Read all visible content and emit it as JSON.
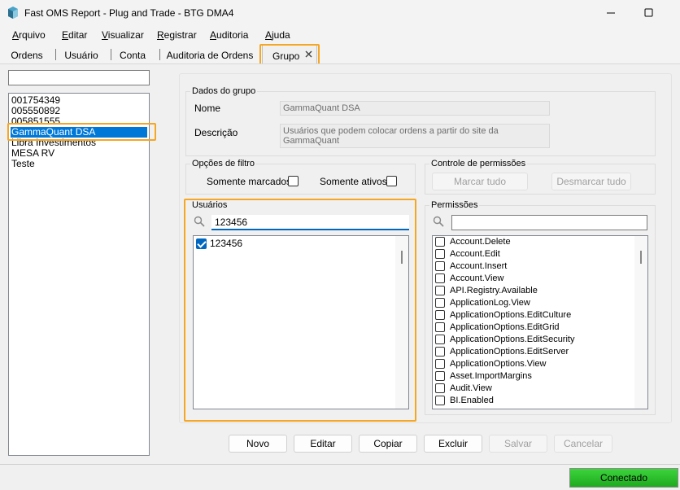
{
  "window": {
    "title": "Fast OMS Report - Plug and Trade - BTG DMA4"
  },
  "menu": [
    {
      "label": "Arquivo"
    },
    {
      "label": "Editar"
    },
    {
      "label": "Visualizar"
    },
    {
      "label": "Registrar"
    },
    {
      "label": "Auditoria"
    },
    {
      "label": "Ajuda"
    }
  ],
  "tabs": [
    {
      "label": "Ordens"
    },
    {
      "label": "Usuário"
    },
    {
      "label": "Conta"
    },
    {
      "label": "Auditoria de Ordens"
    },
    {
      "label": "Grupo",
      "active": true
    }
  ],
  "groups": {
    "search_value": "",
    "items": [
      "001754349",
      "005550892",
      "005851555",
      "GammaQuant DSA",
      "Libra Investimentos",
      "MESA RV",
      "Teste"
    ],
    "selected": "GammaQuant DSA"
  },
  "dados": {
    "legend": "Dados do grupo",
    "nome_label": "Nome",
    "nome_value": "GammaQuant DSA",
    "descricao_label": "Descrição",
    "descricao_value": "Usuários que podem colocar ordens a partir do site da GammaQuant"
  },
  "filtro": {
    "legend": "Opções de filtro",
    "somente_marcados": "Somente marcados",
    "somente_ativos": "Somente ativos"
  },
  "controle": {
    "legend": "Controle de permissões",
    "marcar_tudo": "Marcar tudo",
    "desmarcar_tudo": "Desmarcar tudo"
  },
  "usuarios": {
    "legend": "Usuários",
    "search_value": "123456",
    "items": [
      {
        "label": "123456",
        "checked": true
      }
    ]
  },
  "permissoes": {
    "legend": "Permissões",
    "search_value": "",
    "items": [
      "Account.Delete",
      "Account.Edit",
      "Account.Insert",
      "Account.View",
      "API.Registry.Available",
      "ApplicationLog.View",
      "ApplicationOptions.EditCulture",
      "ApplicationOptions.EditGrid",
      "ApplicationOptions.EditSecurity",
      "ApplicationOptions.EditServer",
      "ApplicationOptions.View",
      "Asset.ImportMargins",
      "Audit.View",
      "BI.Enabled"
    ]
  },
  "actions": {
    "novo": "Novo",
    "editar": "Editar",
    "copiar": "Copiar",
    "excluir": "Excluir",
    "salvar": "Salvar",
    "cancelar": "Cancelar"
  },
  "status": {
    "connection": "Conectado",
    "connection_color": "#2fc42f"
  },
  "colors": {
    "highlight": "#f5a623",
    "selection": "#0078d7"
  }
}
